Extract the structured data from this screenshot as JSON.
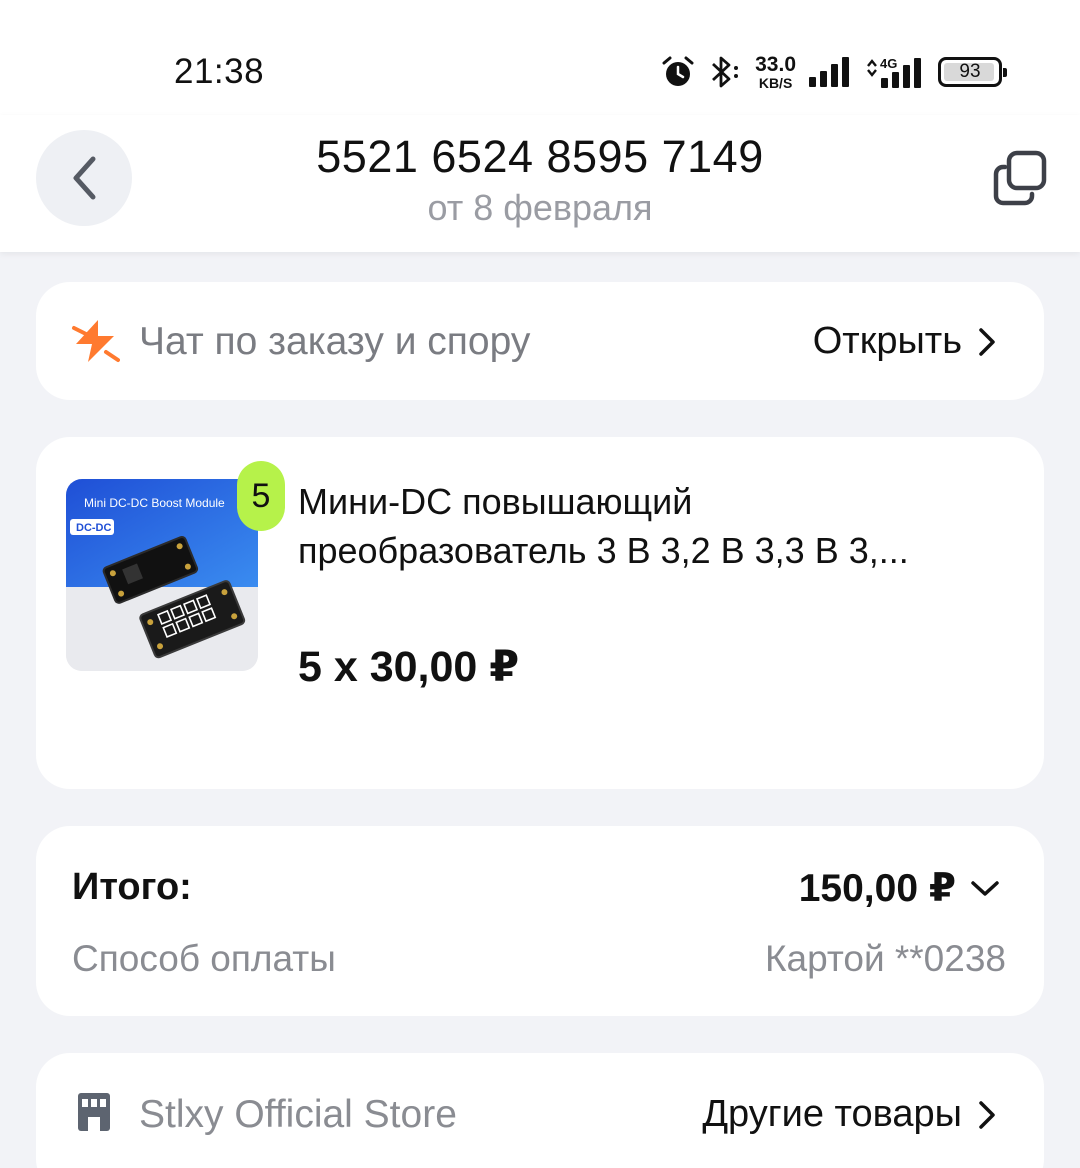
{
  "status_bar": {
    "time": "21:38",
    "net_speed_value": "33.0",
    "net_speed_unit": "KB/S",
    "network_type": "4G",
    "battery": "93",
    "icons": [
      "alarm-icon",
      "bluetooth-icon",
      "signal-icon",
      "signal-4g-icon",
      "battery-icon"
    ]
  },
  "header": {
    "order_number": "5521 6524 8595 7149",
    "order_date": "от 8 февраля",
    "back_icon": "chevron-left-icon",
    "copy_icon": "copy-icon"
  },
  "chat": {
    "label": "Чат по заказу и спору",
    "action": "Открыть",
    "icon": "lightning-icon"
  },
  "product": {
    "quantity_badge": "5",
    "title_line1": "Мини-DC повышающий",
    "title_line2": "преобразователь 3 В 3,2 В 3,3 В 3,...",
    "price": "5 x 30,00 ₽",
    "image_caption": "Mini DC-DC Boost Module",
    "image_tag": "DC-DC"
  },
  "total": {
    "label": "Итого:",
    "value": "150,00 ₽",
    "payment_label": "Способ оплаты",
    "payment_value": "Картой **0238"
  },
  "store": {
    "name": "Stlxy Official Store",
    "action": "Другие товары",
    "icon": "store-icon"
  },
  "colors": {
    "background": "#f2f3f7",
    "card": "#ffffff",
    "badge": "#b6f24a",
    "accent_orange": "#ff7a2f",
    "muted_text": "#8a8c92"
  }
}
